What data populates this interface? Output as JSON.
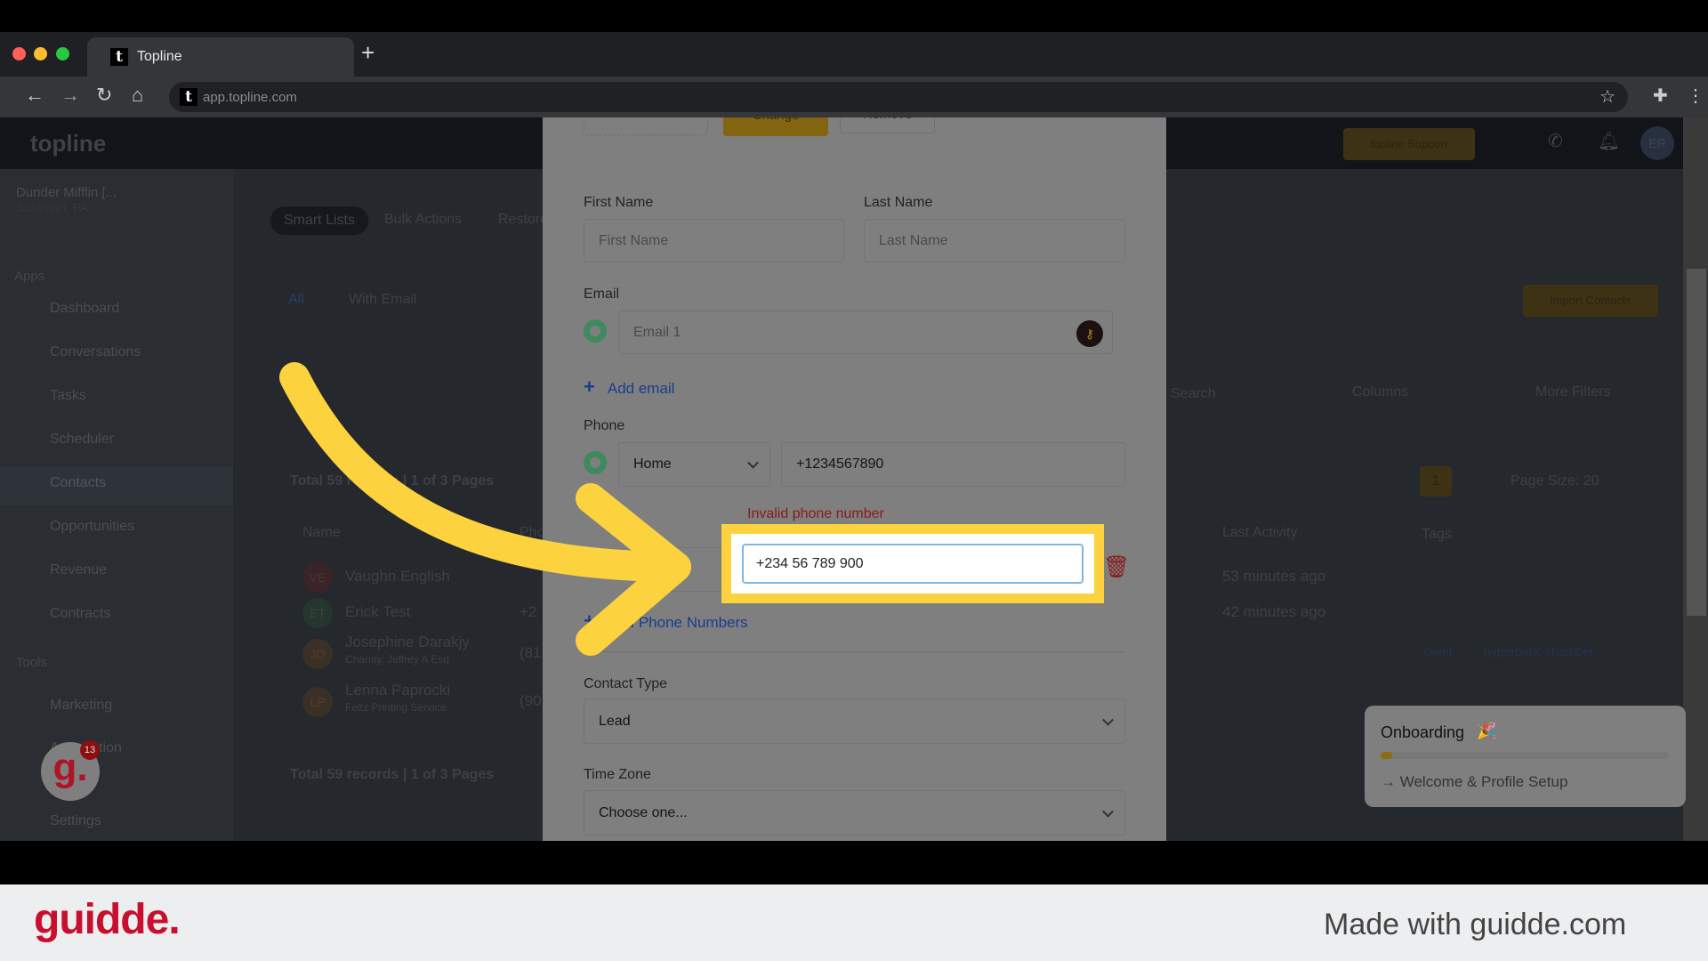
{
  "browser": {
    "tab_title": "Topline",
    "url": "app.topline.com",
    "favicon": "t"
  },
  "app": {
    "logo": "topline",
    "support_label": "topline Support",
    "avatar": "ER",
    "account": {
      "name": "Dunder Mifflin [...",
      "location": "Scranton, PA"
    },
    "sidebar": {
      "apps_heading": "Apps",
      "items": [
        "Dashboard",
        "Conversations",
        "Tasks",
        "Scheduler",
        "Contacts",
        "Opportunities",
        "Revenue",
        "Contracts"
      ],
      "tools_heading": "Tools",
      "tools": [
        "Marketing",
        "Automation",
        "Settings"
      ]
    },
    "top_tabs": [
      "Smart Lists",
      "Bulk Actions",
      "Restore"
    ],
    "list_tabs": [
      "All",
      "With Email"
    ],
    "import_label": "Import Contacts",
    "search_placeholder": "Search",
    "columns_label": "Columns",
    "more_filters_label": "More Filters",
    "records_summary": "Total 59 records | 1 of 3 Pages",
    "page": "1",
    "page_size": "Page Size: 20",
    "columns": {
      "name": "Name",
      "phone": "Phone",
      "last_activity": "Last Activity",
      "tags": "Tags"
    },
    "rows": [
      {
        "initials": "VE",
        "name": "Vaughn English",
        "sub": "",
        "phone": "",
        "activity": "53 minutes ago",
        "tags": []
      },
      {
        "initials": "ET",
        "name": "Erick Test",
        "sub": "",
        "phone": "+2",
        "activity": "42 minutes ago",
        "tags": []
      },
      {
        "initials": "JD",
        "name": "Josephine Darakjy",
        "sub": "Chanay, Jeffrey A Esq",
        "phone": "(81",
        "activity": "",
        "tags": [
          "client",
          "hyperbaric chamber"
        ]
      },
      {
        "initials": "LP",
        "name": "Lenna Paprocki",
        "sub": "Feltz Printing Service",
        "phone": "(90",
        "activity": "",
        "tags": []
      }
    ],
    "guidde_badge": "13"
  },
  "modal": {
    "change_label": "Change",
    "remove_label": "Remove",
    "first_name": {
      "label": "First Name",
      "placeholder": "First Name",
      "value": ""
    },
    "last_name": {
      "label": "Last Name",
      "placeholder": "Last Name",
      "value": ""
    },
    "email": {
      "label": "Email",
      "placeholder": "Email 1",
      "add_label": "Add email"
    },
    "phone": {
      "label": "Phone",
      "type": "Home",
      "value": "+1234567890",
      "error": "Invalid phone number",
      "second_value": "+234 56 789 900",
      "add_label": "Add Phone Numbers"
    },
    "contact_type": {
      "label": "Contact Type",
      "value": "Lead"
    },
    "time_zone": {
      "label": "Time Zone",
      "value": "Choose one..."
    }
  },
  "onboarding": {
    "title": "Onboarding",
    "progress_percent": 4,
    "step": "Welcome & Profile Setup"
  },
  "footer": {
    "brand": "guidde.",
    "tagline": "Made with guidde.com"
  },
  "colors": {
    "highlight": "#fdd23f",
    "error": "#a11d1d",
    "link": "#1a3c8f",
    "brand_red": "#c8102e"
  }
}
